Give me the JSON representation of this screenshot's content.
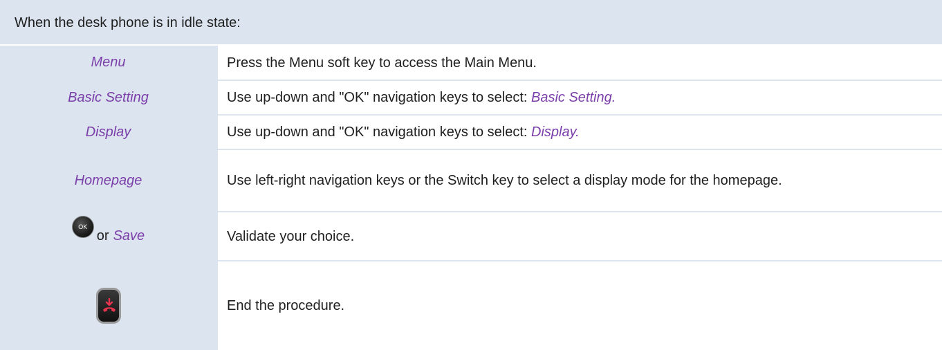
{
  "header": {
    "text": "When the desk phone is in idle state:"
  },
  "rows": [
    {
      "key": "Menu",
      "desc": "Press the Menu soft key to access the Main Menu."
    },
    {
      "key": "Basic Setting",
      "desc_prefix": "Use up-down and \"OK\" navigation keys to select: ",
      "desc_em": "Basic Setting."
    },
    {
      "key": "Display",
      "desc_prefix": "Use up-down and \"OK\" navigation keys to select: ",
      "desc_em": "Display."
    },
    {
      "key": "Homepage",
      "desc": "Use left-right navigation keys or the Switch key to select a display mode for the homepage."
    },
    {
      "ok_label": "OK",
      "or": "or",
      "key": "Save",
      "desc": "Validate your choice."
    },
    {
      "icon": "hang-up-key-icon",
      "desc": "End the procedure."
    }
  ],
  "colors": {
    "header_bg": "#dce4ef",
    "key_text": "#7b3fa9",
    "hangup_red": "#e8344e"
  }
}
